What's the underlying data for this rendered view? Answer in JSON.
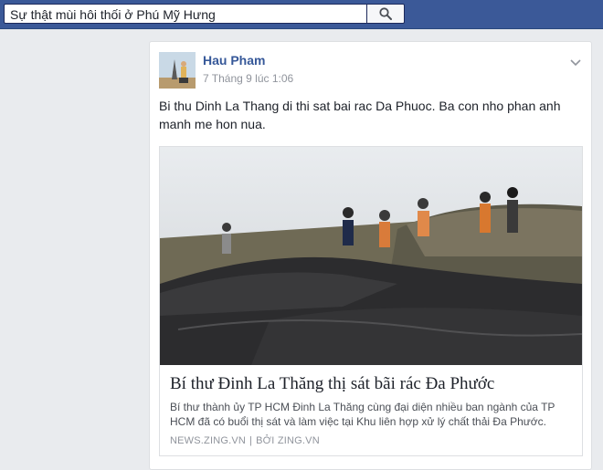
{
  "search": {
    "value": "Sự thật mùi hôi thối ở Phú Mỹ Hưng"
  },
  "post": {
    "author": "Hau Pham",
    "timestamp": "7 Tháng 9 lúc 1:06",
    "text": "Bi thu Dinh La Thang di thi sat bai rac Da Phuoc. Ba con nho phan anh manh me hon nua.",
    "link": {
      "title": "Bí thư Đinh La Thăng thị sát bãi rác Đa Phước",
      "description": "Bí thư thành ủy TP HCM Đinh La Thăng cùng đại diện nhiều ban ngành của TP HCM đã có buổi thị sát và làm việc tại Khu liên hợp xử lý chất thải Đa Phước.",
      "domain": "NEWS.ZING.VN",
      "separator": "|",
      "byline": "BỞI ZING.VN"
    }
  },
  "colors": {
    "topbar": "#3b5998",
    "author_link": "#365899",
    "page_bg": "#e9ebee"
  },
  "icons": {
    "search_button": "search-icon",
    "post_menu": "chevron-down-icon"
  }
}
